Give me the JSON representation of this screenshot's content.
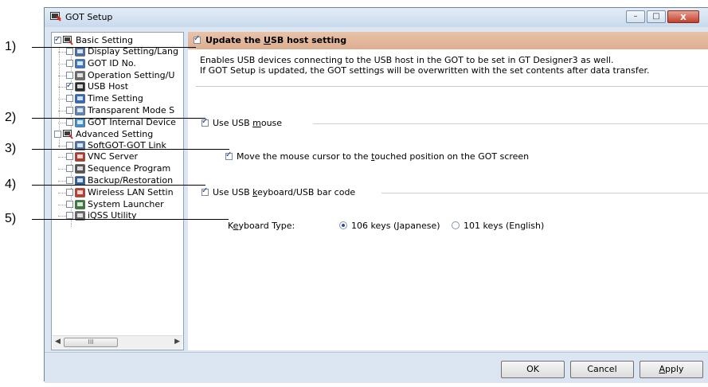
{
  "callouts": [
    "1)",
    "2)",
    "3)",
    "4)",
    "5)"
  ],
  "window": {
    "title": "GOT Setup",
    "controls": {
      "minimize": "–",
      "maximize": "□",
      "close": "x"
    }
  },
  "tree": {
    "groups": [
      {
        "label": "Basic Setting",
        "checked": true,
        "items": [
          {
            "label": "Display Setting/Lang",
            "icon": "display-icon",
            "checked": false
          },
          {
            "label": "GOT ID No.",
            "icon": "id-icon",
            "checked": false
          },
          {
            "label": "Operation Setting/U",
            "icon": "operation-icon",
            "checked": false
          },
          {
            "label": "USB Host",
            "icon": "usb-icon",
            "checked": true
          },
          {
            "label": "Time Setting",
            "icon": "clock-icon",
            "checked": false
          },
          {
            "label": "Transparent Mode S",
            "icon": "transparent-icon",
            "checked": false
          },
          {
            "label": "GOT Internal Device",
            "icon": "device-icon",
            "checked": false
          }
        ]
      },
      {
        "label": "Advanced Setting",
        "checked": false,
        "items": [
          {
            "label": "SoftGOT-GOT Link",
            "icon": "link-icon",
            "checked": false
          },
          {
            "label": "VNC Server",
            "icon": "vnc-icon",
            "checked": false
          },
          {
            "label": "Sequence Program",
            "icon": "sequence-icon",
            "checked": false
          },
          {
            "label": "Backup/Restoration",
            "icon": "backup-icon",
            "checked": false
          },
          {
            "label": "Wireless LAN Settin",
            "icon": "wireless-icon",
            "checked": false
          },
          {
            "label": "System Launcher",
            "icon": "launcher-icon",
            "checked": false
          },
          {
            "label": "iQSS Utility",
            "icon": "utility-icon",
            "checked": false
          }
        ]
      }
    ],
    "scroll_thumb": "III"
  },
  "main": {
    "update_setting": {
      "pre": "Update the ",
      "key": "U",
      "post": "SB host setting",
      "checked": true
    },
    "description": [
      "Enables USB devices connecting to the USB host in the GOT to be set in GT Designer3 as well.",
      "If GOT Setup is updated, the GOT settings will be overwritten with the set contents after data transfer."
    ],
    "use_mouse": {
      "pre": "Use USB ",
      "key": "m",
      "post": "ouse",
      "checked": true
    },
    "move_cursor": {
      "pre": "Move the mouse cursor to the ",
      "key": "t",
      "post": "ouched position on the GOT screen",
      "checked": true
    },
    "use_keyboard": {
      "pre": "Use USB ",
      "key": "k",
      "post": "eyboard/USB bar code",
      "checked": true
    },
    "keyboard_type": {
      "pre": "K",
      "key": "e",
      "post": "yboard Type:",
      "options": [
        "106 keys (Japanese)",
        "101 keys (English)"
      ],
      "selected": "106 keys (Japanese)"
    }
  },
  "footer": {
    "ok": "OK",
    "cancel": "Cancel",
    "apply": {
      "key": "A",
      "post": "pply"
    }
  },
  "colors": {
    "section_header": "#dcaf91",
    "window_bg": "#dbe6f2",
    "close_button": "#c2402c"
  }
}
